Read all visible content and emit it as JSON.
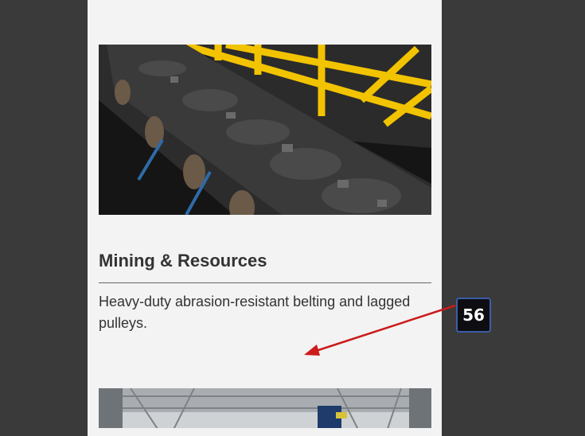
{
  "card": {
    "title": "Mining & Resources",
    "description": "Heavy-duty abrasion-resistant belting and lagged pulleys."
  },
  "images": {
    "top": "conveyor-belt-with-coal-photo",
    "bottom": "industrial-hangar-photo"
  },
  "annotation": {
    "label": "56",
    "color": "#cc1b1b"
  }
}
